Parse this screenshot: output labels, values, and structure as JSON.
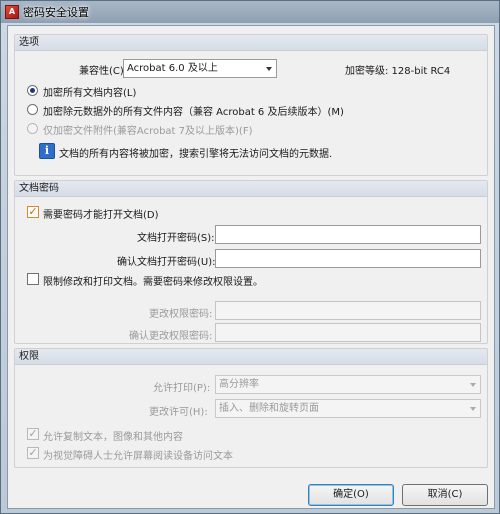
{
  "window": {
    "title": "密码安全设置",
    "icon": "pdf-lock-icon"
  },
  "options": {
    "heading": "选项",
    "compat_label": "兼容性(C):",
    "compat_value": "Acrobat 6.0 及以上",
    "encryption_level": "加密等级: 128-bit RC4",
    "radio_all": "加密所有文档内容(L)",
    "radio_except_meta": "加密除元数据外的所有文件内容（兼容 Acrobat 6 及后续版本）(M)",
    "radio_attachments": "仅加密文件附件(兼容Acrobat 7及以上版本)(F)",
    "info_text": "文档的所有内容将被加密，搜索引擎将无法访问文档的元数据."
  },
  "doc_password": {
    "heading": "文档密码",
    "require_label": "需要密码才能打开文档(D)",
    "open_pw_label": "文档打开密码(S):",
    "open_pw_value": "",
    "confirm_pw_label": "确认文档打开密码(U):",
    "confirm_pw_value": "",
    "restrict_label": "限制修改和打印文档。需要密码来修改权限设置。",
    "perm_pw_label": "更改权限密码:",
    "confirm_perm_pw_label": "确认更改权限密码:"
  },
  "permissions": {
    "heading": "权限",
    "print_label": "允许打印(P):",
    "print_value": "高分辨率",
    "change_label": "更改许可(H):",
    "change_value": "插入、删除和旋转页面",
    "copy_label": "允许复制文本，图像和其他内容",
    "screen_reader_label": "为视觉障碍人士允许屏幕阅读设备访问文本"
  },
  "buttons": {
    "ok": "确定(O)",
    "cancel": "取消(C)"
  }
}
